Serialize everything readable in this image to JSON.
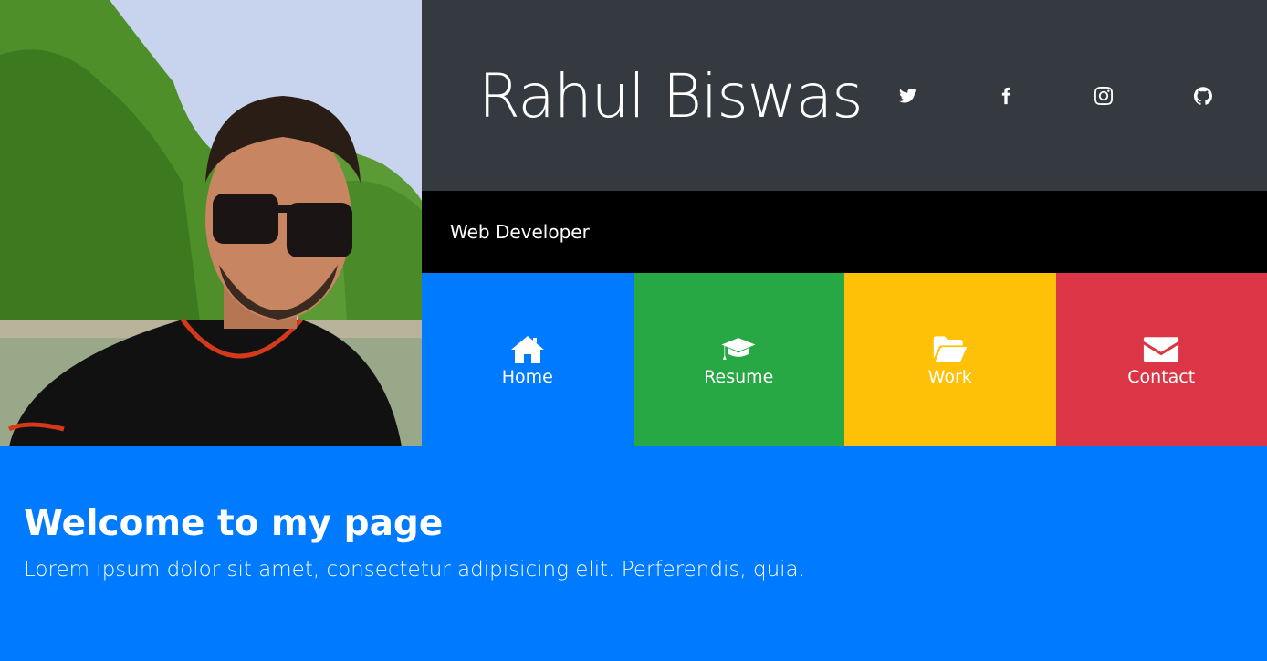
{
  "profile": {
    "name": "Rahul Biswas",
    "role": "Web Developer"
  },
  "social": [
    {
      "icon": "twitter-icon"
    },
    {
      "icon": "facebook-icon"
    },
    {
      "icon": "instagram-icon"
    },
    {
      "icon": "github-icon"
    }
  ],
  "nav": [
    {
      "label": "Home",
      "icon": "home-icon",
      "color": "#007bff"
    },
    {
      "label": "Resume",
      "icon": "graduation-cap-icon",
      "color": "#28a745"
    },
    {
      "label": "Work",
      "icon": "folder-open-icon",
      "color": "#ffc107"
    },
    {
      "label": "Contact",
      "icon": "envelope-icon",
      "color": "#dc3545"
    }
  ],
  "welcome": {
    "title": "Welcome to my page",
    "text": "Lorem ipsum dolor sit amet, consectetur adipisicing elit. Perferendis, quia."
  },
  "colors": {
    "header": "#343a40",
    "subtitle_bar": "#000000",
    "welcome_bg": "#007bff"
  }
}
